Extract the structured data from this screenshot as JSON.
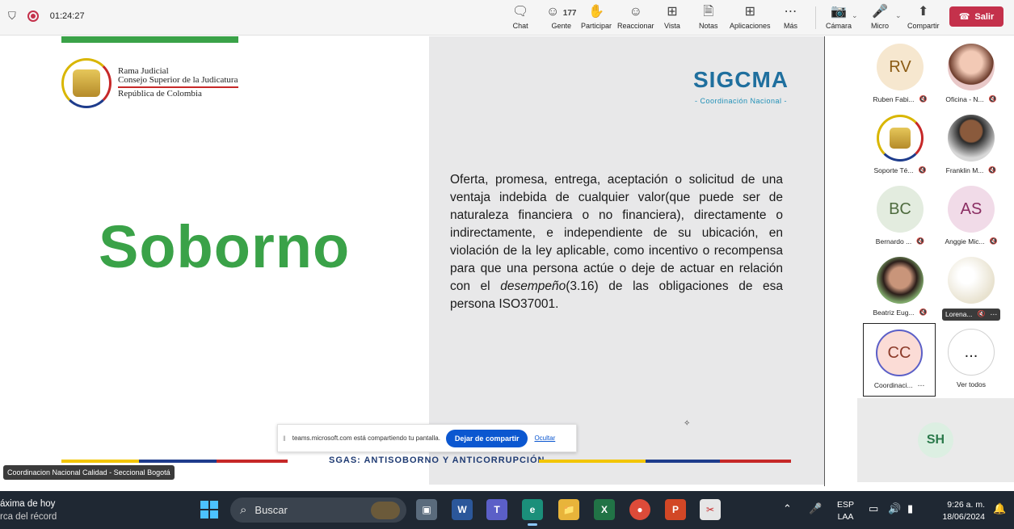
{
  "topbar": {
    "timer": "01:24:27",
    "buttons": [
      {
        "key": "chat",
        "label": "Chat",
        "icon": "chat-icon"
      },
      {
        "key": "people",
        "label": "Gente",
        "count": "177",
        "icon": "people-icon"
      },
      {
        "key": "raise",
        "label": "Participar",
        "icon": "hand-icon"
      },
      {
        "key": "react",
        "label": "Reaccionar",
        "icon": "smile-icon"
      },
      {
        "key": "view",
        "label": "Vista",
        "icon": "grid-icon"
      },
      {
        "key": "notes",
        "label": "Notas",
        "icon": "notes-icon"
      },
      {
        "key": "apps",
        "label": "Aplicaciones",
        "icon": "plus-icon"
      },
      {
        "key": "more",
        "label": "Más",
        "icon": "more-icon"
      },
      {
        "key": "camera",
        "label": "Cámara",
        "icon": "camera-off-icon"
      },
      {
        "key": "mic",
        "label": "Micro",
        "icon": "mic-off-icon"
      },
      {
        "key": "share",
        "label": "Compartir",
        "icon": "share-icon"
      }
    ],
    "leave_label": "Salir"
  },
  "slide": {
    "org_line1": "Rama Judicial",
    "org_line2": "Consejo Superior de la Judicatura",
    "org_line3": "República de Colombia",
    "title": "Soborno",
    "brand": "SIGCMA",
    "brand_sub": "- Coordinación Nacional -",
    "definition_before": "Oferta, promesa, entrega, aceptación o solicitud de una ventaja indebida de cualquier valor(que puede ser de naturaleza financiera o no financiera), directamente o indirectamente, e independiente de su ubicación, en violación de la ley aplicable, como incentivo o recompensa para que una persona actúe o deje de actuar en relación con el ",
    "definition_em": "desempeño",
    "definition_after": "(3.16) de las obligaciones de esa persona ISO37001.",
    "footer": "SGAS: ANTISOBORNO Y ANTICORRUPCIÓN"
  },
  "share_bar": {
    "message": "teams.microsoft.com está compartiendo tu pantalla.",
    "stop_label": "Dejar de compartir",
    "hide_label": "Ocultar"
  },
  "presenter_caption": "Coordinacion Nacional Calidad - Seccional Bogotá",
  "participants": [
    {
      "initials": "RV",
      "name": "Ruben Fabi...",
      "bg": "#f6e7cf",
      "fg": "#8a5a12"
    },
    {
      "initials": "",
      "name": "Oficina - N...",
      "bg": "#e9c8c8",
      "fg": "#000000"
    },
    {
      "initials": "",
      "name": "Soporte Té...",
      "bg": "#ffffff",
      "fg": "#000000"
    },
    {
      "initials": "",
      "name": "Franklin M...",
      "bg": "#d8d8d8",
      "fg": "#000000"
    },
    {
      "initials": "BC",
      "name": "Bernardo ...",
      "bg": "#e3ecdf",
      "fg": "#4e6b3e"
    },
    {
      "initials": "AS",
      "name": "Anggie Mic...",
      "bg": "#f1dbe8",
      "fg": "#8a2d62"
    },
    {
      "initials": "",
      "name": "Beatriz Eug...",
      "bg": "#c9a08a",
      "fg": "#000000"
    },
    {
      "initials": "",
      "name": "Lorena...",
      "bg": "#e8e2cf",
      "fg": "#000000"
    },
    {
      "initials": "CC",
      "name": "Coordinaci...",
      "bg": "#fbdcd6",
      "fg": "#8c3b2a"
    },
    {
      "initials": "...",
      "name": "Ver todos",
      "bg": "#ffffff",
      "fg": "#242424"
    }
  ],
  "speaker_initials": "SH",
  "taskbar": {
    "weather_line1": "áxima de hoy",
    "weather_line2": "rca del récord",
    "search_label": "Buscar",
    "lang_line1": "ESP",
    "lang_line2": "LAA",
    "time": "9:26 a. m.",
    "date": "18/06/2024"
  },
  "colors": {
    "accent_green": "#3aa248",
    "leave_red": "#c4314b",
    "stop_blue": "#0b57d0"
  }
}
